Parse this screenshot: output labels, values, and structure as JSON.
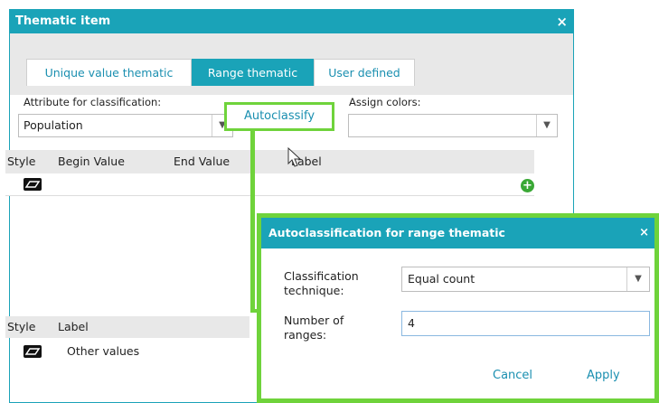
{
  "dialog": {
    "title": "Thematic item",
    "close_glyph": "×",
    "tabs": [
      {
        "label": "Unique value thematic",
        "active": false
      },
      {
        "label": "Range thematic",
        "active": true
      },
      {
        "label": "User defined",
        "active": false
      }
    ],
    "attribute_label": "Attribute for classification:",
    "attribute_value": "Population",
    "autoclassify_label": "Autoclassify",
    "assign_colors_label": "Assign colors:",
    "assign_colors_value": "",
    "range_grid": {
      "columns": [
        "Style",
        "Begin Value",
        "End Value",
        "Label"
      ],
      "add_icon": "+"
    },
    "other_grid": {
      "columns": [
        "Style",
        "Label"
      ],
      "rows": [
        {
          "label": "Other values"
        }
      ]
    }
  },
  "popup": {
    "title": "Autoclassification for range thematic",
    "close_glyph": "×",
    "technique_label_line1": "Classification",
    "technique_label_line2": "technique:",
    "technique_value": "Equal count",
    "ranges_label_line1": "Number of",
    "ranges_label_line2": "ranges:",
    "ranges_value": "4",
    "cancel_label": "Cancel",
    "apply_label": "Apply"
  },
  "colors": {
    "accent": "#1aa3b8",
    "highlight": "#6fd33b",
    "link": "#1a8fb0",
    "add_button": "#3aa835"
  },
  "icons": [
    "close-icon",
    "chevron-down-icon",
    "style-swatch-icon",
    "add-icon",
    "mouse-cursor-icon"
  ]
}
